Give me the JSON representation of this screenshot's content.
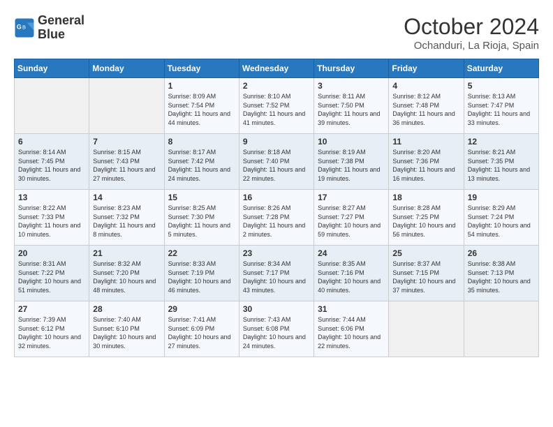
{
  "logo": {
    "line1": "General",
    "line2": "Blue"
  },
  "title": "October 2024",
  "subtitle": "Ochanduri, La Rioja, Spain",
  "days_of_week": [
    "Sunday",
    "Monday",
    "Tuesday",
    "Wednesday",
    "Thursday",
    "Friday",
    "Saturday"
  ],
  "weeks": [
    [
      {
        "day": "",
        "info": ""
      },
      {
        "day": "",
        "info": ""
      },
      {
        "day": "1",
        "info": "Sunrise: 8:09 AM\nSunset: 7:54 PM\nDaylight: 11 hours and 44 minutes."
      },
      {
        "day": "2",
        "info": "Sunrise: 8:10 AM\nSunset: 7:52 PM\nDaylight: 11 hours and 41 minutes."
      },
      {
        "day": "3",
        "info": "Sunrise: 8:11 AM\nSunset: 7:50 PM\nDaylight: 11 hours and 39 minutes."
      },
      {
        "day": "4",
        "info": "Sunrise: 8:12 AM\nSunset: 7:48 PM\nDaylight: 11 hours and 36 minutes."
      },
      {
        "day": "5",
        "info": "Sunrise: 8:13 AM\nSunset: 7:47 PM\nDaylight: 11 hours and 33 minutes."
      }
    ],
    [
      {
        "day": "6",
        "info": "Sunrise: 8:14 AM\nSunset: 7:45 PM\nDaylight: 11 hours and 30 minutes."
      },
      {
        "day": "7",
        "info": "Sunrise: 8:15 AM\nSunset: 7:43 PM\nDaylight: 11 hours and 27 minutes."
      },
      {
        "day": "8",
        "info": "Sunrise: 8:17 AM\nSunset: 7:42 PM\nDaylight: 11 hours and 24 minutes."
      },
      {
        "day": "9",
        "info": "Sunrise: 8:18 AM\nSunset: 7:40 PM\nDaylight: 11 hours and 22 minutes."
      },
      {
        "day": "10",
        "info": "Sunrise: 8:19 AM\nSunset: 7:38 PM\nDaylight: 11 hours and 19 minutes."
      },
      {
        "day": "11",
        "info": "Sunrise: 8:20 AM\nSunset: 7:36 PM\nDaylight: 11 hours and 16 minutes."
      },
      {
        "day": "12",
        "info": "Sunrise: 8:21 AM\nSunset: 7:35 PM\nDaylight: 11 hours and 13 minutes."
      }
    ],
    [
      {
        "day": "13",
        "info": "Sunrise: 8:22 AM\nSunset: 7:33 PM\nDaylight: 11 hours and 10 minutes."
      },
      {
        "day": "14",
        "info": "Sunrise: 8:23 AM\nSunset: 7:32 PM\nDaylight: 11 hours and 8 minutes."
      },
      {
        "day": "15",
        "info": "Sunrise: 8:25 AM\nSunset: 7:30 PM\nDaylight: 11 hours and 5 minutes."
      },
      {
        "day": "16",
        "info": "Sunrise: 8:26 AM\nSunset: 7:28 PM\nDaylight: 11 hours and 2 minutes."
      },
      {
        "day": "17",
        "info": "Sunrise: 8:27 AM\nSunset: 7:27 PM\nDaylight: 10 hours and 59 minutes."
      },
      {
        "day": "18",
        "info": "Sunrise: 8:28 AM\nSunset: 7:25 PM\nDaylight: 10 hours and 56 minutes."
      },
      {
        "day": "19",
        "info": "Sunrise: 8:29 AM\nSunset: 7:24 PM\nDaylight: 10 hours and 54 minutes."
      }
    ],
    [
      {
        "day": "20",
        "info": "Sunrise: 8:31 AM\nSunset: 7:22 PM\nDaylight: 10 hours and 51 minutes."
      },
      {
        "day": "21",
        "info": "Sunrise: 8:32 AM\nSunset: 7:20 PM\nDaylight: 10 hours and 48 minutes."
      },
      {
        "day": "22",
        "info": "Sunrise: 8:33 AM\nSunset: 7:19 PM\nDaylight: 10 hours and 46 minutes."
      },
      {
        "day": "23",
        "info": "Sunrise: 8:34 AM\nSunset: 7:17 PM\nDaylight: 10 hours and 43 minutes."
      },
      {
        "day": "24",
        "info": "Sunrise: 8:35 AM\nSunset: 7:16 PM\nDaylight: 10 hours and 40 minutes."
      },
      {
        "day": "25",
        "info": "Sunrise: 8:37 AM\nSunset: 7:15 PM\nDaylight: 10 hours and 37 minutes."
      },
      {
        "day": "26",
        "info": "Sunrise: 8:38 AM\nSunset: 7:13 PM\nDaylight: 10 hours and 35 minutes."
      }
    ],
    [
      {
        "day": "27",
        "info": "Sunrise: 7:39 AM\nSunset: 6:12 PM\nDaylight: 10 hours and 32 minutes."
      },
      {
        "day": "28",
        "info": "Sunrise: 7:40 AM\nSunset: 6:10 PM\nDaylight: 10 hours and 30 minutes."
      },
      {
        "day": "29",
        "info": "Sunrise: 7:41 AM\nSunset: 6:09 PM\nDaylight: 10 hours and 27 minutes."
      },
      {
        "day": "30",
        "info": "Sunrise: 7:43 AM\nSunset: 6:08 PM\nDaylight: 10 hours and 24 minutes."
      },
      {
        "day": "31",
        "info": "Sunrise: 7:44 AM\nSunset: 6:06 PM\nDaylight: 10 hours and 22 minutes."
      },
      {
        "day": "",
        "info": ""
      },
      {
        "day": "",
        "info": ""
      }
    ]
  ]
}
